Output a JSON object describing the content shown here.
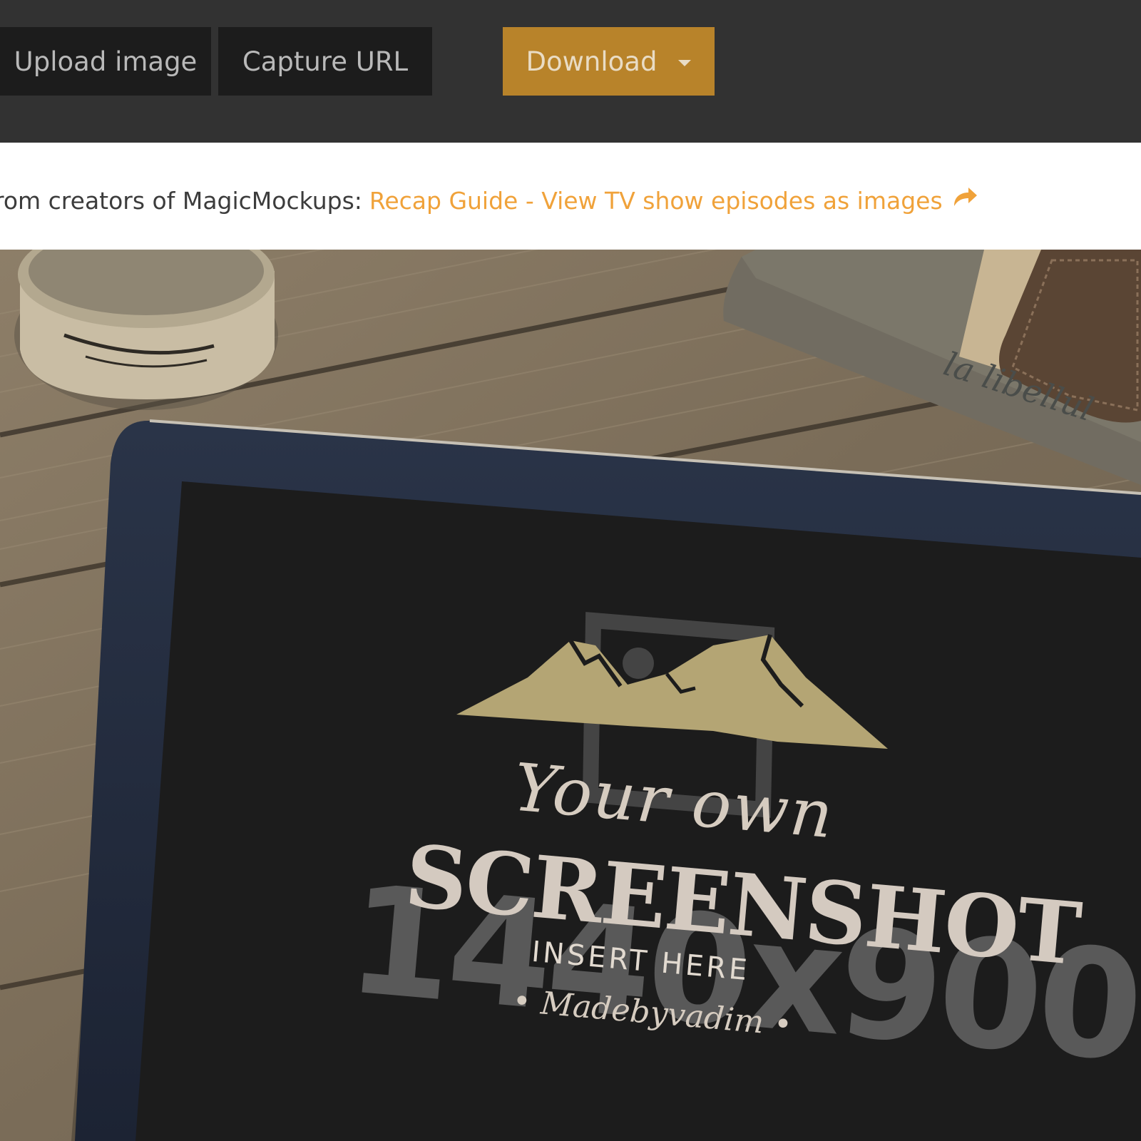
{
  "toolbar": {
    "upload_label": "Upload image",
    "capture_label": "Capture URL",
    "download_label": "Download"
  },
  "promo": {
    "text": "rom creators of MagicMockups:",
    "link_text": "Recap Guide - View TV show episodes as images"
  },
  "mockup": {
    "script_line": "Your own",
    "title_line": "SCREENSHOT",
    "insert_line": "INSERT HERE",
    "maker_line": "• Madebyvadim •",
    "dimensions": "1440x900",
    "fabric_text": "la libellul"
  },
  "colors": {
    "toolbar_bg": "#323232",
    "button_bg": "#1c1c1c",
    "download_bg": "#b8832a",
    "link": "#f0a23a",
    "screen_bg": "#1c1c1c",
    "mountain": "#b4a574"
  }
}
